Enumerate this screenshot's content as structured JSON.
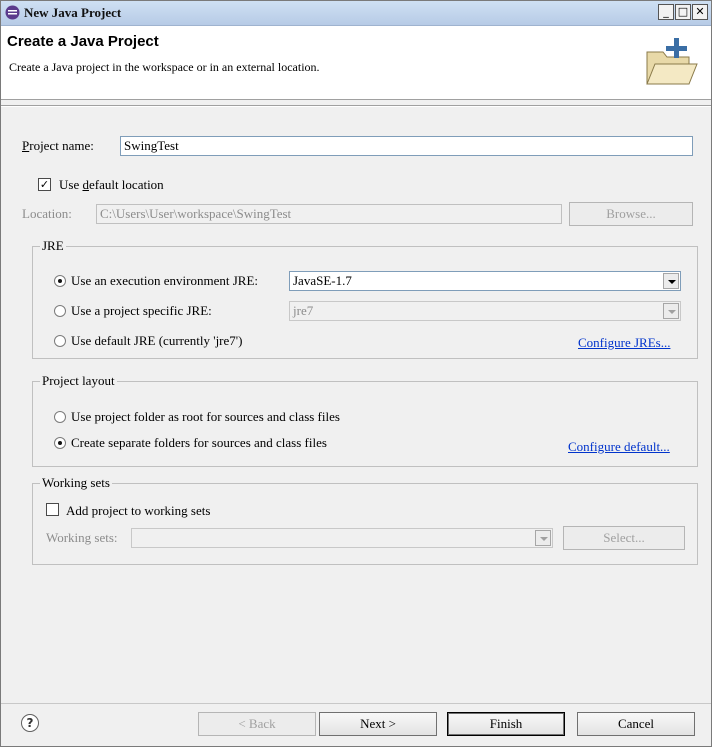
{
  "window": {
    "title": "New Java Project",
    "controls": [
      "_",
      "□",
      "✕"
    ]
  },
  "header": {
    "title": "Create a Java Project",
    "description": "Create a Java project in the workspace or in an external location."
  },
  "project": {
    "name_label_mnemonic": "P",
    "name_label_rest": "roject name:",
    "name_value": "SwingTest",
    "default_location_pre": "Use ",
    "default_location_mnemonic": "d",
    "default_location_post": "efault location",
    "default_location_checked": true,
    "location_label": "Location:",
    "location_value": "C:\\Users\\User\\workspace\\SwingTest",
    "browse_label": "Browse..."
  },
  "jre": {
    "group_title": "JRE",
    "opt1_label": "Use an execution environment JRE:",
    "opt1_value": "JavaSE-1.7",
    "opt2_label": "Use a project specific JRE:",
    "opt2_value": "jre7",
    "opt3_label": "Use default JRE (currently 'jre7')",
    "configure_link": "Configure JREs...",
    "selected": 1
  },
  "layout": {
    "group_title": "Project layout",
    "opt1_label": "Use project folder as root for sources and class files",
    "opt2_label": "Create separate folders for sources and class files",
    "configure_link": "Configure default...",
    "selected": 2
  },
  "working_sets": {
    "group_title": "Working sets",
    "checkbox_label": "Add project to working sets",
    "checked": false,
    "label": "Working sets:",
    "value": "",
    "select_label": "Select..."
  },
  "footer": {
    "help_label": "?",
    "back_label": "< Back",
    "next_label": "Next >",
    "finish_label": "Finish",
    "cancel_label": "Cancel"
  },
  "colors": {
    "link": "#0033cc",
    "titlebar": "#c4d7ee",
    "dialog_bg": "#f0f0f0"
  }
}
